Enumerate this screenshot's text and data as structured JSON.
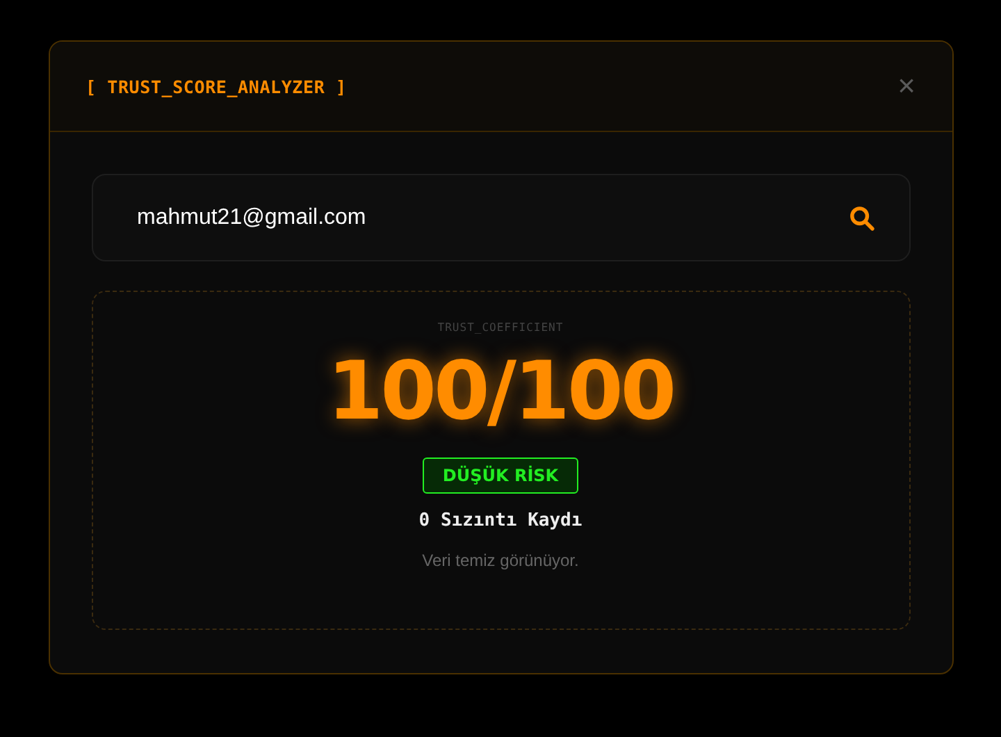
{
  "dialog": {
    "title": "[ TRUST_SCORE_ANALYZER ]",
    "close": "×"
  },
  "search": {
    "value": "mahmut21@gmail.com"
  },
  "result": {
    "caption": "TRUST_COEFFICIENT",
    "score": "100/100",
    "badge": {
      "label": "DÜŞÜK RİSK",
      "kind": "low"
    },
    "leaks": "0 Sızıntı Kaydı",
    "note": "Veri temiz görünüyor."
  }
}
